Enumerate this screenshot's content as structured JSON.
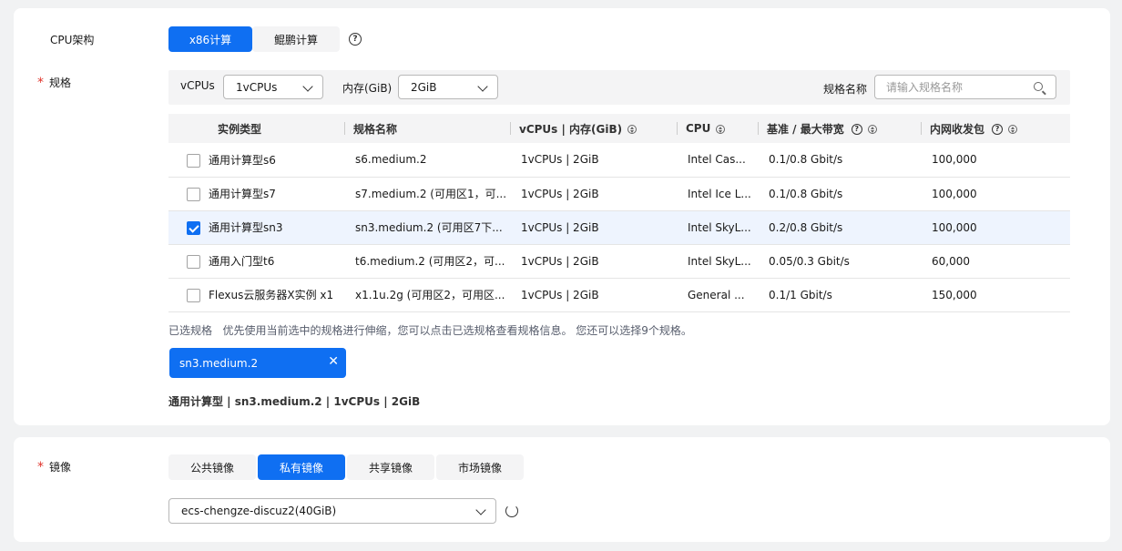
{
  "cpu_arch": {
    "label": "CPU架构",
    "options": [
      "x86计算",
      "鲲鹏计算"
    ],
    "selected": "x86计算"
  },
  "spec": {
    "required_mark": "*",
    "label": "规格",
    "vcpus_label": "vCPUs",
    "vcpus_value": "1vCPUs",
    "memory_label": "内存(GiB)",
    "memory_value": "2GiB",
    "name_label": "规格名称",
    "name_placeholder": "请输入规格名称",
    "columns": [
      "实例类型",
      "规格名称",
      "vCPUs | 内存(GiB)",
      "CPU",
      "基准 / 最大带宽",
      "内网收发包"
    ],
    "rows": [
      {
        "type": "通用计算型s6",
        "name": "s6.medium.2",
        "vcpu_mem": "1vCPUs | 2GiB",
        "cpu": "Intel Cas...",
        "bandwidth": "0.1/0.8 Gbit/s",
        "pps": "100,000",
        "checked": false
      },
      {
        "type": "通用计算型s7",
        "name": "s7.medium.2 (可用区1，可...",
        "vcpu_mem": "1vCPUs | 2GiB",
        "cpu": "Intel Ice L...",
        "bandwidth": "0.1/0.8 Gbit/s",
        "pps": "100,000",
        "checked": false
      },
      {
        "type": "通用计算型sn3",
        "name": "sn3.medium.2 (可用区7下...",
        "vcpu_mem": "1vCPUs | 2GiB",
        "cpu": "Intel SkyL...",
        "bandwidth": "0.2/0.8 Gbit/s",
        "pps": "100,000",
        "checked": true
      },
      {
        "type": "通用入门型t6",
        "name": "t6.medium.2 (可用区2，可...",
        "vcpu_mem": "1vCPUs | 2GiB",
        "cpu": "Intel SkyL...",
        "bandwidth": "0.05/0.3 Gbit/s",
        "pps": "60,000",
        "checked": false
      },
      {
        "type": "Flexus云服务器X实例 x1",
        "name": "x1.1u.2g (可用区2，可用区...",
        "vcpu_mem": "1vCPUs | 2GiB",
        "cpu": "General ...",
        "bandwidth": "0.1/1 Gbit/s",
        "pps": "150,000",
        "checked": false
      }
    ],
    "selected_label": "已选规格",
    "selected_hint": "优先使用当前选中的规格进行伸缩，您可以点击已选规格查看规格信息。 您还可以选择9个规格。",
    "selected_chip": "sn3.medium.2",
    "chip_close": "✕",
    "summary": "通用计算型 | sn3.medium.2 | 1vCPUs | 2GiB"
  },
  "image": {
    "required_mark": "*",
    "label": "镜像",
    "tabs": [
      "公共镜像",
      "私有镜像",
      "共享镜像",
      "市场镜像"
    ],
    "selected_tab": "私有镜像",
    "select_value": "ecs-chengze-discuz2(40GiB)"
  },
  "icons": {
    "help": "question-circle-icon",
    "sort": "sort-icon",
    "search": "search-icon",
    "refresh": "refresh-icon",
    "accent": "#0f6ff2"
  }
}
